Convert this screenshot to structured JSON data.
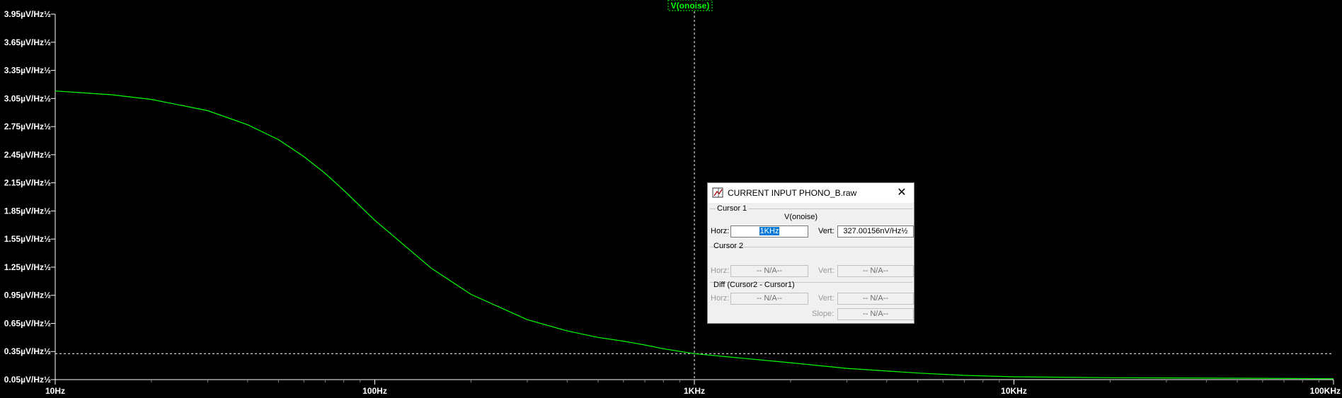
{
  "plot": {
    "trace_label": "V(onoise)",
    "trace_color": "#00ff00",
    "background": "#000000",
    "cursor_color": "#ffffff"
  },
  "chart_data": {
    "type": "line",
    "x_scale": "log",
    "xlim": [
      10,
      100000
    ],
    "ylim": [
      0.05,
      3.95
    ],
    "x_ticks": [
      "10Hz",
      "100Hz",
      "1KHz",
      "10KHz",
      "100KHz"
    ],
    "y_ticks": [
      "3.95µV/Hz½",
      "3.65µV/Hz½",
      "3.35µV/Hz½",
      "3.05µV/Hz½",
      "2.75µV/Hz½",
      "2.45µV/Hz½",
      "2.15µV/Hz½",
      "1.85µV/Hz½",
      "1.55µV/Hz½",
      "1.25µV/Hz½",
      "0.95µV/Hz½",
      "0.65µV/Hz½",
      "0.35µV/Hz½",
      "0.05µV/Hz½"
    ],
    "y_tick_values": [
      3.95,
      3.65,
      3.35,
      3.05,
      2.75,
      2.45,
      2.15,
      1.85,
      1.55,
      1.25,
      0.95,
      0.65,
      0.35,
      0.05
    ],
    "series": [
      {
        "name": "V(onoise)",
        "x": [
          10,
          15,
          20,
          30,
          40,
          50,
          60,
          70,
          80,
          100,
          150,
          200,
          300,
          400,
          500,
          600,
          700,
          800,
          1000,
          1500,
          2000,
          3000,
          5000,
          7000,
          10000,
          20000,
          50000,
          100000
        ],
        "y": [
          3.13,
          3.09,
          3.04,
          2.92,
          2.77,
          2.61,
          2.43,
          2.25,
          2.07,
          1.75,
          1.24,
          0.96,
          0.69,
          0.57,
          0.5,
          0.46,
          0.42,
          0.38,
          0.327,
          0.27,
          0.23,
          0.17,
          0.12,
          0.095,
          0.08,
          0.07,
          0.065,
          0.06
        ]
      }
    ],
    "cursor": {
      "x": 1000,
      "y": 0.327
    }
  },
  "dialog": {
    "title": "CURRENT INPUT PHONO_B.raw",
    "icon": "cursor-plot-icon",
    "cursor1_label": "Cursor 1",
    "trace_name": "V(onoise)",
    "horz_label": "Horz:",
    "vert_label": "Vert:",
    "cursor1_horz": "1KHz",
    "cursor1_vert": "327.00156nV/Hz½",
    "cursor2_label": "Cursor 2",
    "cursor2_horz": "-- N/A--",
    "cursor2_vert": "-- N/A--",
    "diff_label": "Diff (Cursor2 - Cursor1)",
    "diff_horz": "-- N/A--",
    "diff_vert": "-- N/A--",
    "slope_label": "Slope:",
    "diff_slope": "-- N/A--"
  }
}
